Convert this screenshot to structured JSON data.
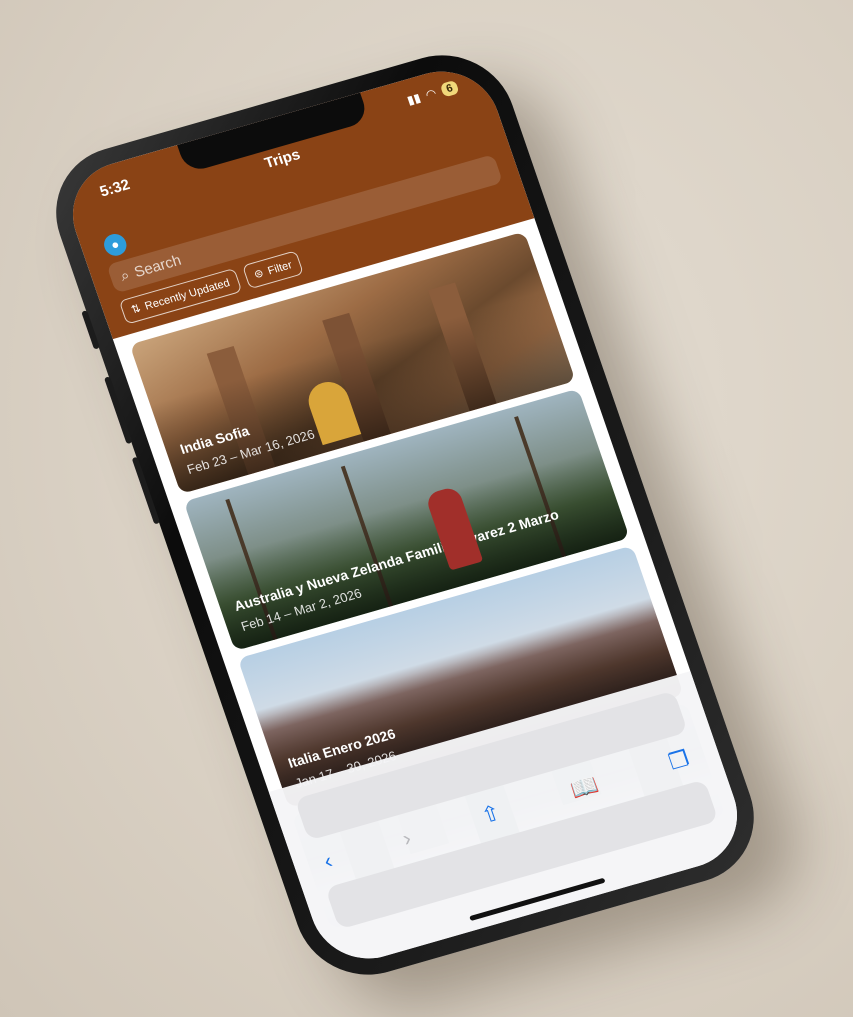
{
  "status": {
    "time": "5:32",
    "battery": "6"
  },
  "header": {
    "title": "Trips"
  },
  "search": {
    "placeholder": "Search"
  },
  "chips": {
    "sort": "Recently Updated",
    "filter": "Filter"
  },
  "trips": [
    {
      "name": "India Sofia",
      "dates": "Feb 23 – Mar 16, 2026"
    },
    {
      "name": "Australia y Nueva Zelanda Familia Álvarez 2 Marzo",
      "dates": "Feb 14 – Mar 2, 2026"
    },
    {
      "name": "Italia Enero 2026",
      "dates": "Jan 17 – 30, 2026"
    }
  ],
  "colors": {
    "header_bg": "#8a4315",
    "accent": "#1a73e8",
    "avatar": "#2d9cdb"
  },
  "toolbar": {
    "icons": [
      "back-icon",
      "forward-icon",
      "share-icon",
      "bookmarks-icon",
      "tabs-icon"
    ]
  }
}
